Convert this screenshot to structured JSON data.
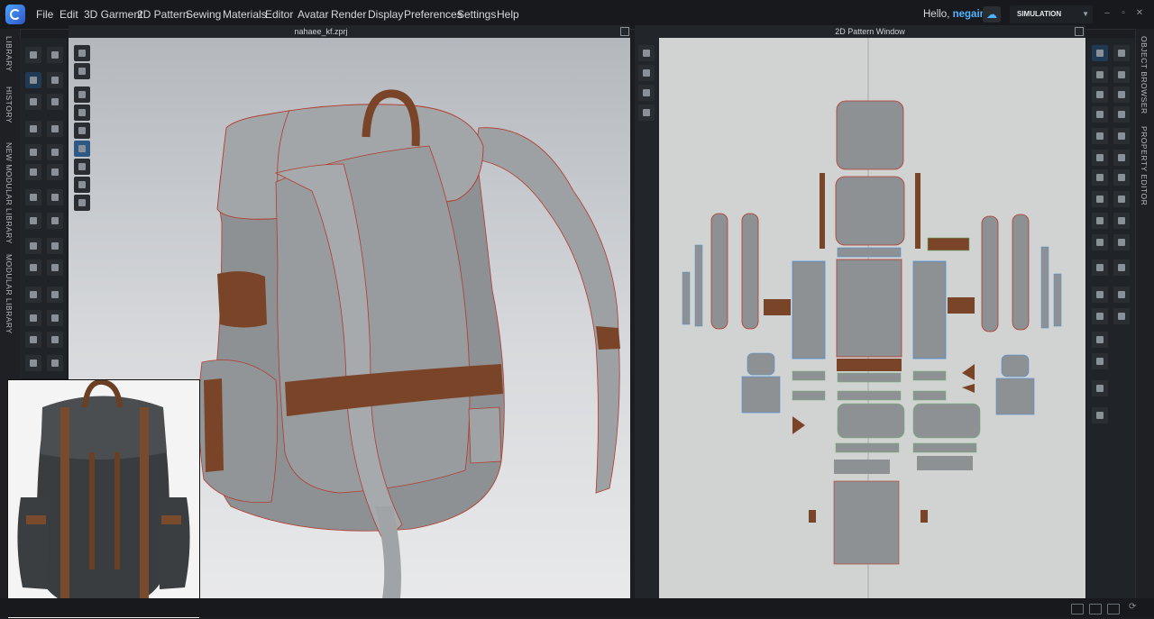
{
  "menubar": {
    "items": [
      "File",
      "Edit",
      "3D Garment",
      "2D Pattern",
      "Sewing",
      "Materials",
      "Editor",
      "Avatar",
      "Render",
      "Display",
      "Preferences",
      "Settings",
      "Help"
    ],
    "greeting": "Hello,",
    "user": "negain",
    "mode_label": "SIMULATION"
  },
  "panels": {
    "view3d_title": "nahaee_kf.zprj",
    "view2d_title": "2D Pattern Window"
  },
  "left_tabs": [
    "LIBRARY",
    "HISTORY",
    "NEW MODULAR LIBRARY",
    "MODULAR LIBRARY"
  ],
  "right_tabs": [
    "OBJECT BROWSER",
    "PROPERTY EDITOR"
  ],
  "colors": {
    "accent": "#4fb4ff",
    "fabric": "#8e9193",
    "leather": "#7a4428",
    "seam": "#c0392b"
  },
  "icons": {
    "logo": "clo-logo-icon",
    "cloud": "cloud-sync-icon",
    "dropdown": "chevron-down-icon"
  }
}
